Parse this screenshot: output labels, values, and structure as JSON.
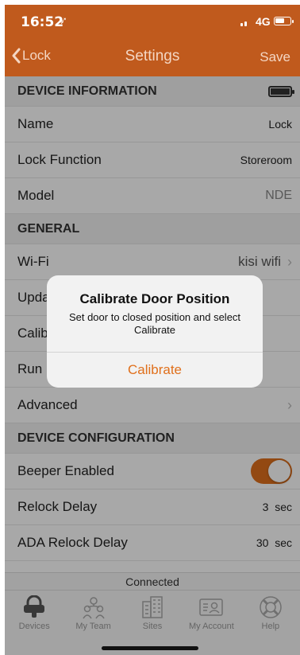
{
  "status": {
    "time": "16:52",
    "network": "4G"
  },
  "nav": {
    "back_label": "Lock",
    "title": "Settings",
    "save_label": "Save"
  },
  "sections": {
    "device_info": "DEVICE INFORMATION",
    "general": "GENERAL",
    "device_config": "DEVICE CONFIGURATION"
  },
  "rows": {
    "name": {
      "label": "Name",
      "value": "Lock"
    },
    "lock_function": {
      "label": "Lock Function",
      "value": "Storeroom"
    },
    "model": {
      "label": "Model",
      "value": "NDE"
    },
    "wifi": {
      "label": "Wi-Fi",
      "value": "kisi wifi"
    },
    "update": {
      "label": "Upda"
    },
    "calibrate": {
      "label": "Calib"
    },
    "run": {
      "label": "Run"
    },
    "advanced": {
      "label": "Advanced"
    },
    "beeper": {
      "label": "Beeper Enabled",
      "on": true
    },
    "relock": {
      "label": "Relock Delay",
      "value": "3  sec"
    },
    "ada_relock": {
      "label": "ADA Relock Delay",
      "value": "30  sec"
    }
  },
  "connection_status": "Connected",
  "tabs": [
    {
      "label": "Devices",
      "icon": "lock-icon"
    },
    {
      "label": "My Team",
      "icon": "team-icon"
    },
    {
      "label": "Sites",
      "icon": "building-icon"
    },
    {
      "label": "My Account",
      "icon": "account-icon"
    },
    {
      "label": "Help",
      "icon": "lifebuoy-icon"
    }
  ],
  "alert": {
    "title": "Calibrate Door Position",
    "message": "Set door to closed position and select Calibrate",
    "button": "Calibrate"
  },
  "colors": {
    "brand": "#c05a1d",
    "accent": "#e0701c"
  }
}
